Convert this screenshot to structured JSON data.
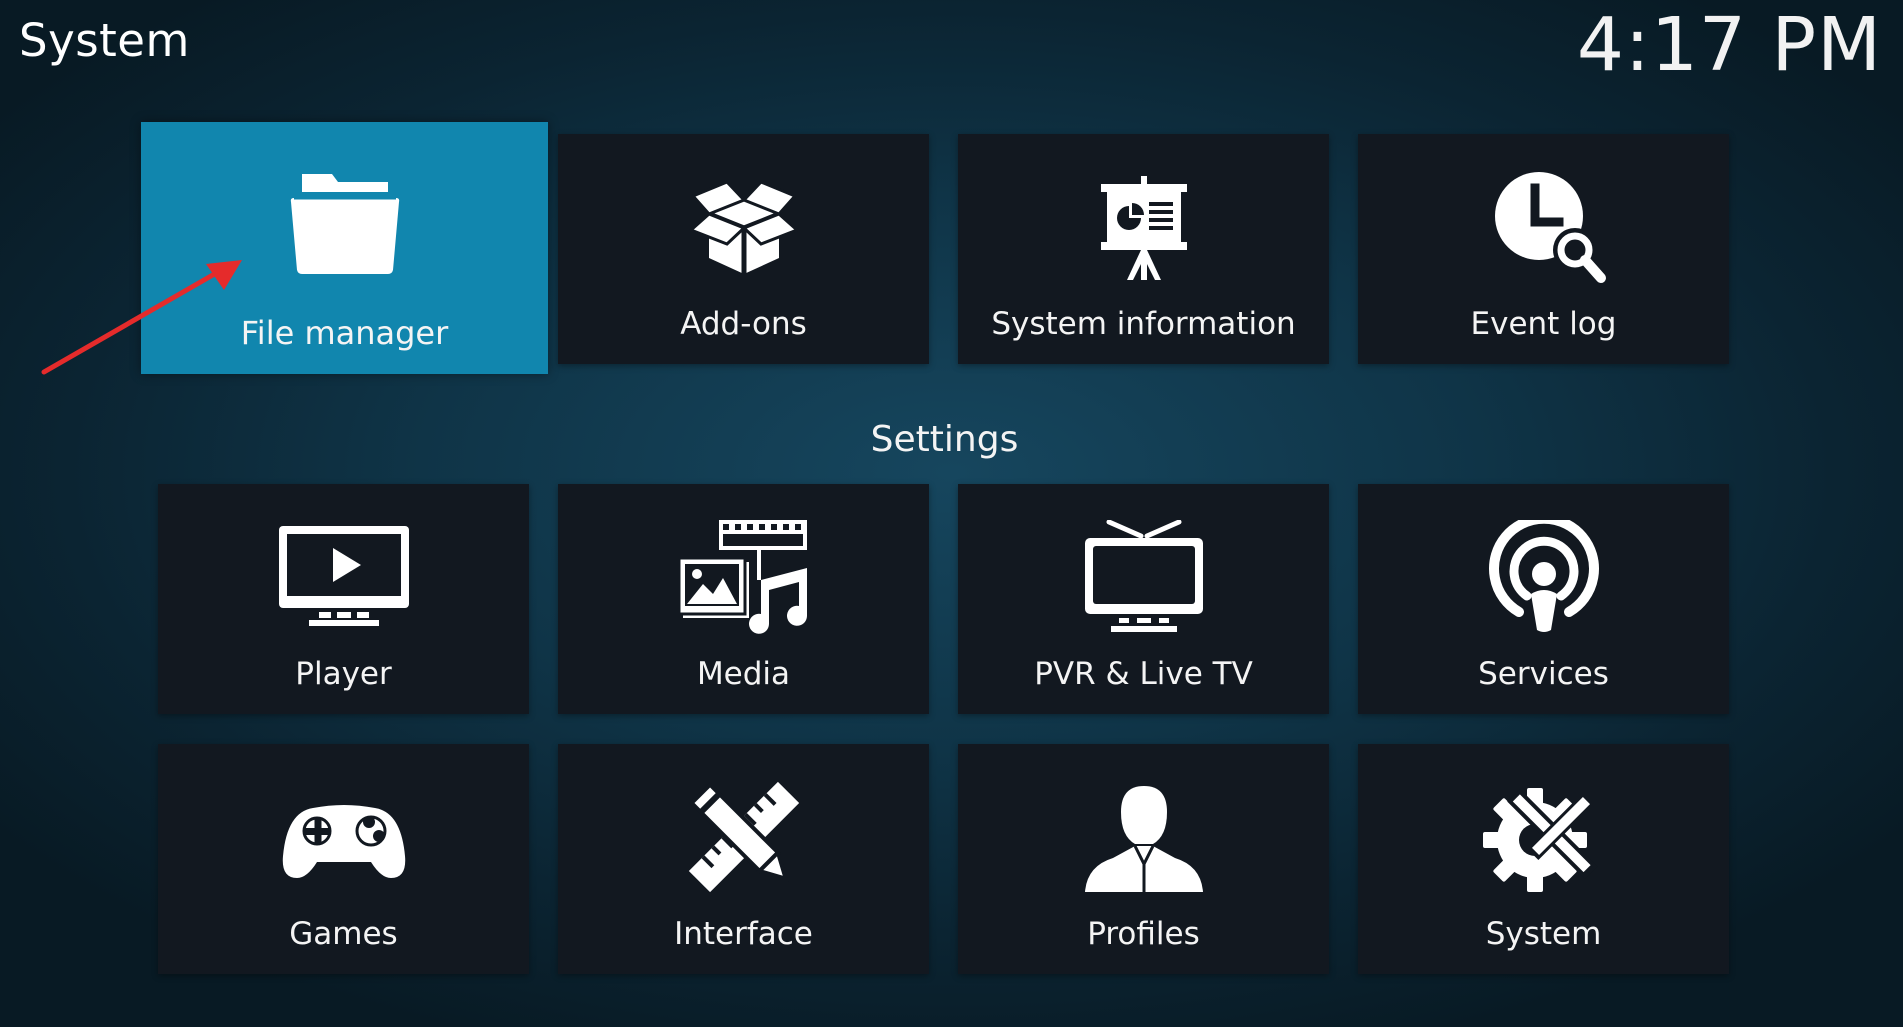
{
  "header": {
    "title": "System",
    "clock": "4:17 PM"
  },
  "top_row": [
    {
      "label": "File manager",
      "icon": "folder-icon",
      "focused": true
    },
    {
      "label": "Add-ons",
      "icon": "box-icon"
    },
    {
      "label": "System information",
      "icon": "presentation-icon"
    },
    {
      "label": "Event log",
      "icon": "clock-search-icon"
    }
  ],
  "settings": {
    "title": "Settings",
    "items": [
      {
        "label": "Player",
        "icon": "monitor-play-icon"
      },
      {
        "label": "Media",
        "icon": "media-icon"
      },
      {
        "label": "PVR & Live TV",
        "icon": "tv-icon"
      },
      {
        "label": "Services",
        "icon": "broadcast-icon"
      },
      {
        "label": "Games",
        "icon": "gamepad-icon"
      },
      {
        "label": "Interface",
        "icon": "pencil-ruler-icon"
      },
      {
        "label": "Profiles",
        "icon": "user-icon"
      },
      {
        "label": "System",
        "icon": "gear-tools-icon"
      }
    ]
  },
  "colors": {
    "focused_tile": "#1186ae",
    "tile": "#121820",
    "annotation": "#e52b2b"
  }
}
